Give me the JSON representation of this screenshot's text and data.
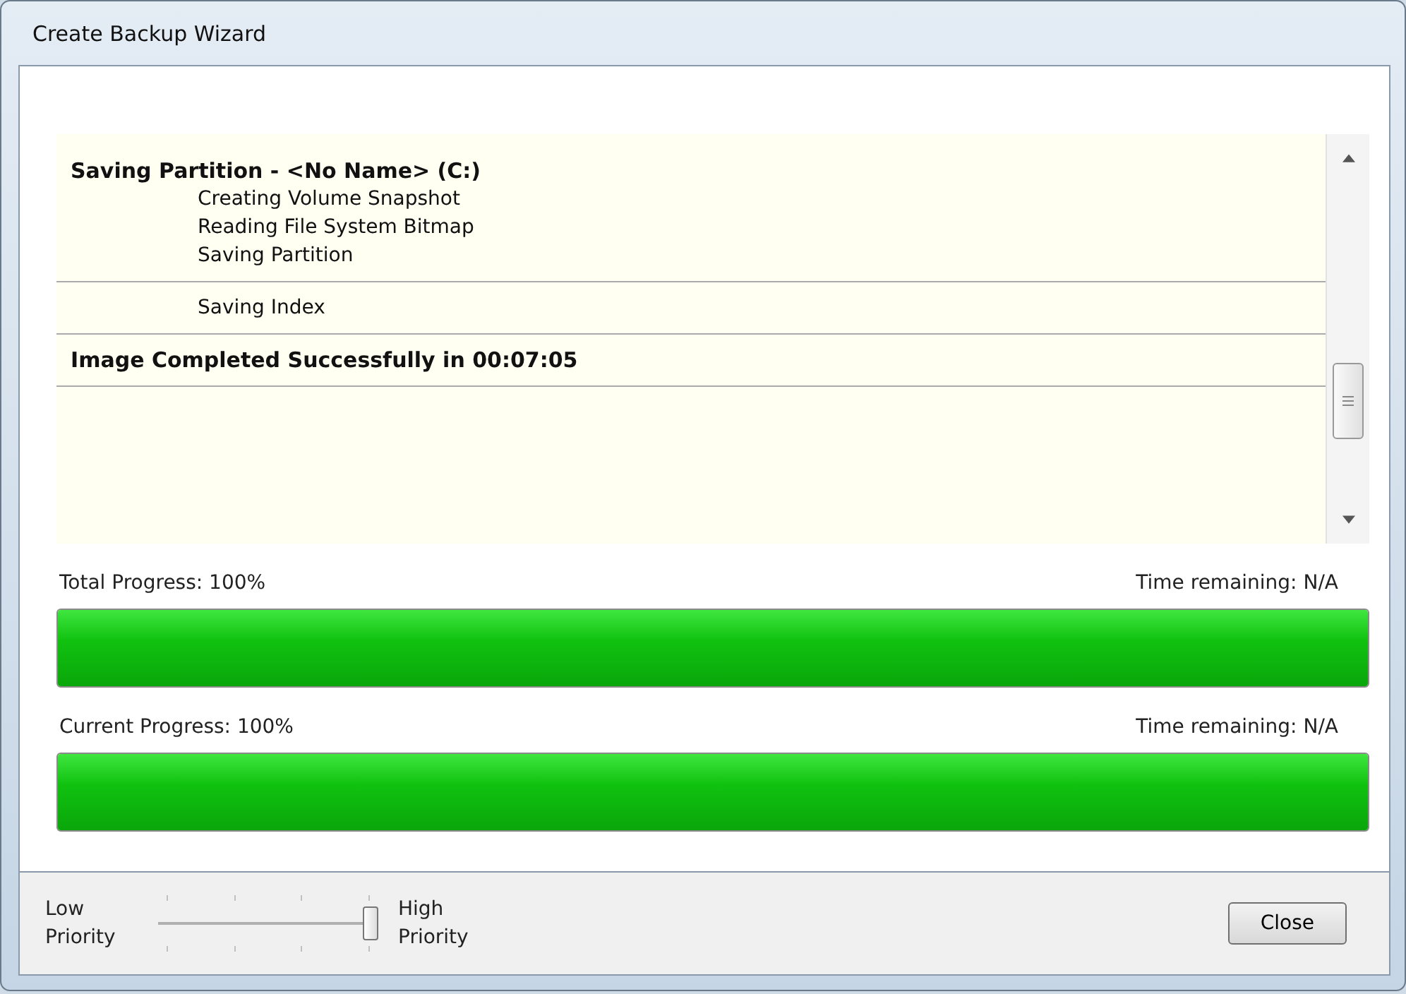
{
  "window": {
    "title": "Create Backup Wizard"
  },
  "log": {
    "groups": [
      {
        "lines": [
          {
            "kind": "heading",
            "text": "Saving Partition - <No Name> (C:)"
          },
          {
            "kind": "step",
            "text": "Creating Volume Snapshot"
          },
          {
            "kind": "step",
            "text": "Reading File System Bitmap"
          },
          {
            "kind": "step",
            "text": "Saving Partition"
          }
        ]
      },
      {
        "lines": [
          {
            "kind": "step",
            "text": "Saving Index"
          }
        ]
      },
      {
        "lines": [
          {
            "kind": "heading",
            "text": "Image Completed Successfully in 00:07:05"
          }
        ]
      }
    ]
  },
  "progress": [
    {
      "label": "Total Progress:  100%",
      "remaining": "Time remaining: N/A",
      "level": 1
    },
    {
      "label": "Current Progress:  100%",
      "remaining": "Time remaining: N/A",
      "level": 1
    }
  ],
  "priority": {
    "low": "Low Priority",
    "high": "High Priority",
    "level": 1
  },
  "buttons": [
    "Close"
  ]
}
